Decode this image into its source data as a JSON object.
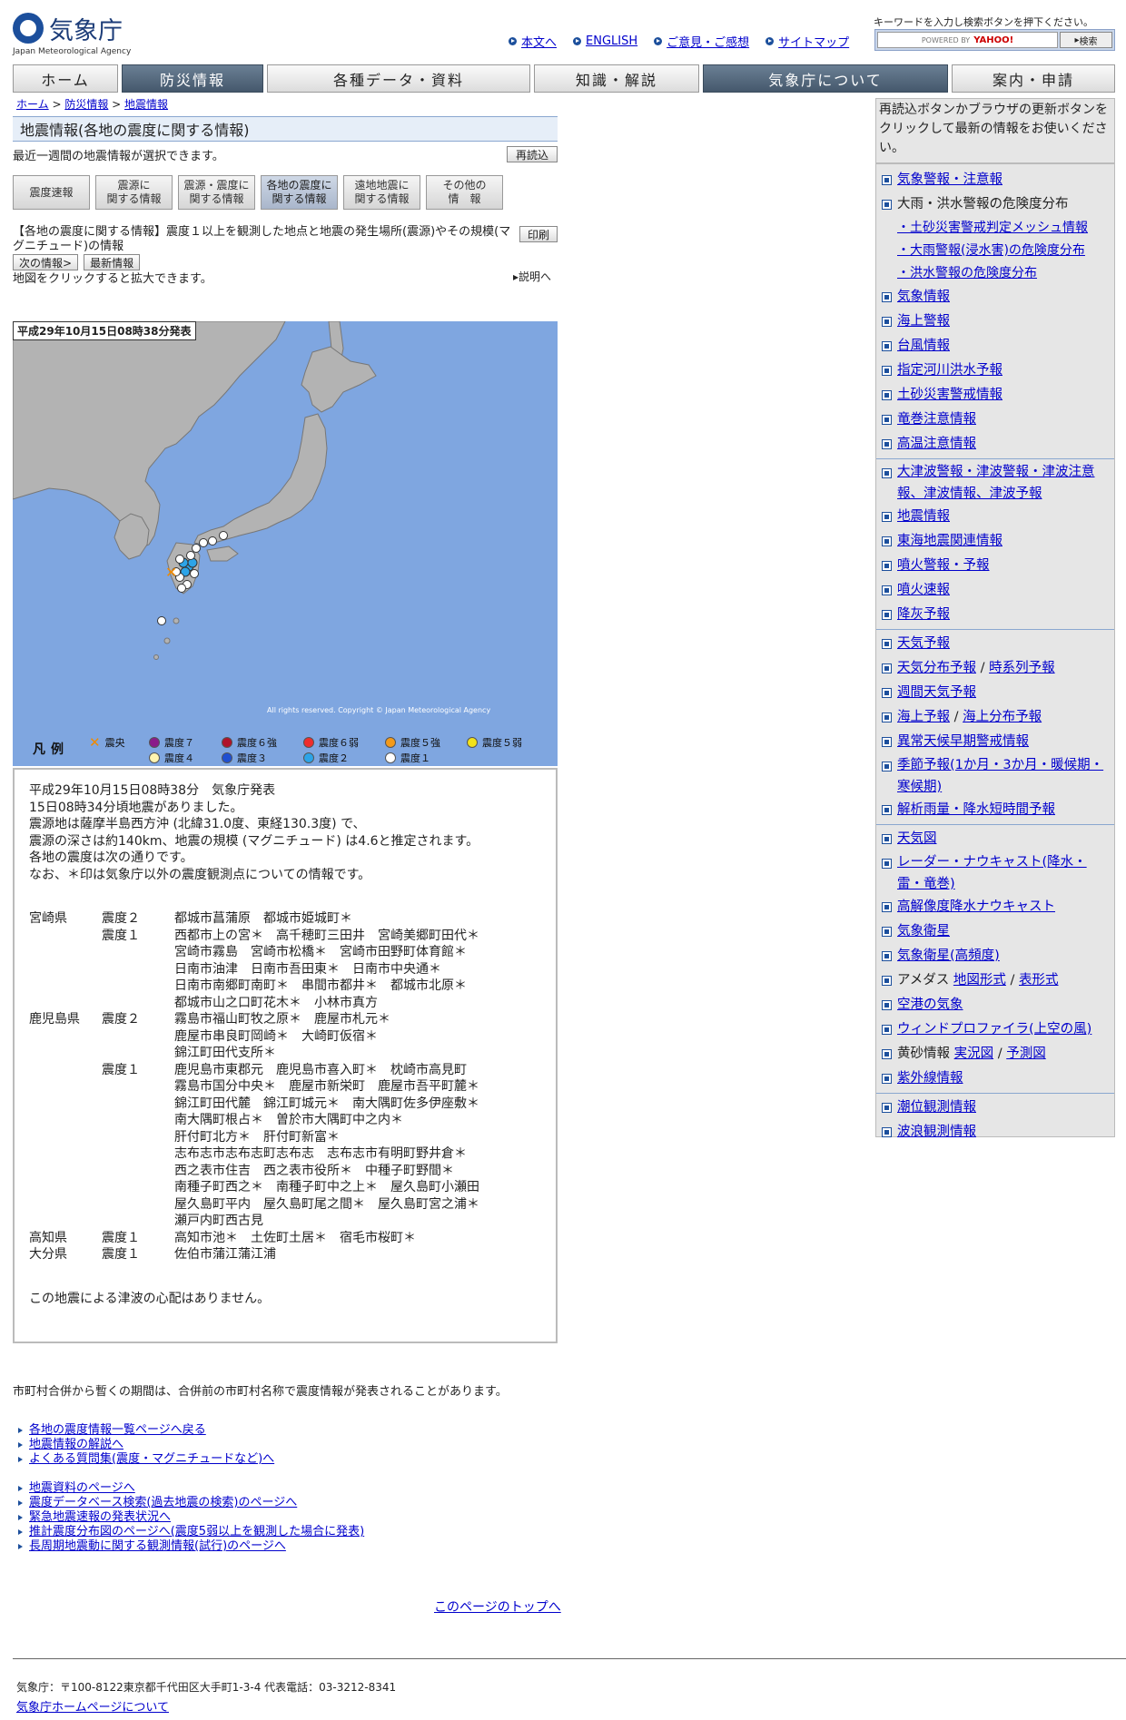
{
  "header": {
    "logo_text": "気象庁",
    "logo_sub": "Japan Meteorological Agency",
    "links": [
      "本文へ",
      "ENGLISH",
      "ご意見・ご感想",
      "サイトマップ"
    ],
    "search_note": "キーワードを入力し検索ボタンを押下ください。",
    "search_powered": "POWERED BY",
    "search_brand": "YAHOO!",
    "search_button": "検索"
  },
  "nav": [
    {
      "label": "ホーム",
      "dark": false
    },
    {
      "label": "防災情報",
      "dark": true
    },
    {
      "label": "各種データ・資料",
      "dark": false
    },
    {
      "label": "知識・解説",
      "dark": false
    },
    {
      "label": "気象庁について",
      "dark": true
    },
    {
      "label": "案内・申請",
      "dark": false
    }
  ],
  "breadcrumb": [
    "ホーム",
    "防災情報",
    "地震情報"
  ],
  "page": {
    "title": "地震情報(各地の震度に関する情報)",
    "subtitle": "最近一週間の地震情報が選択できます。",
    "reload_button": "再読込",
    "print_button": "印刷",
    "tabs": [
      "震度速報",
      "震源に\n関する情報",
      "震源・震度に\n関する情報",
      "各地の震度に\n関する情報",
      "遠地地震に\n関する情報",
      "その他の\n情　報"
    ],
    "active_tab_index": 3,
    "description": "【各地の震度に関する情報】震度１以上を観測した地点と地震の発生場所(震源)やその規模(マグニチュード)の情報",
    "next_button": "次の情報>",
    "latest_button": "最新情報",
    "map_note": "地図をクリックすると拡大できます。",
    "explain_link": "説明へ"
  },
  "map": {
    "stamp": "平成29年10月15日08時38分発表",
    "copyright": "All rights reserved. Copyright © Japan Meteorological Agency",
    "legend_title": "凡例",
    "legend": [
      {
        "label": "震央",
        "kind": "x",
        "color": "#f08a00"
      },
      {
        "label": "震度７",
        "color": "#8a1b8a"
      },
      {
        "label": "震度６強",
        "color": "#b0132a"
      },
      {
        "label": "震度６弱",
        "color": "#ef2d2d"
      },
      {
        "label": "震度５強",
        "color": "#f39a1a"
      },
      {
        "label": "震度５弱",
        "color": "#f2e21a"
      },
      {
        "label": "震度４",
        "color": "#fff4b0"
      },
      {
        "label": "震度３",
        "color": "#1f4fd1"
      },
      {
        "label": "震度２",
        "color": "#2ca4e8"
      },
      {
        "label": "震度１",
        "color": "#ffffff"
      }
    ]
  },
  "report": {
    "lines": [
      "平成29年10月15日08時38分　気象庁発表",
      "15日08時34分頃地震がありました。",
      "震源地は薩摩半島西方沖 (北緯31.0度、東経130.3度) で、",
      "震源の深さは約140km、地震の規模 (マグニチュード) は4.6と推定されます。",
      "各地の震度は次の通りです。",
      "なお、＊印は気象庁以外の震度観測点についての情報です。"
    ],
    "rows": [
      [
        "宮崎県",
        "震度２",
        "都城市菖蒲原　都城市姫城町＊"
      ],
      [
        "",
        "震度１",
        "西都市上の宮＊　高千穂町三田井　宮崎美郷町田代＊"
      ],
      [
        "",
        "",
        "宮崎市霧島　宮崎市松橋＊　宮崎市田野町体育館＊"
      ],
      [
        "",
        "",
        "日南市油津　日南市吾田東＊　日南市中央通＊"
      ],
      [
        "",
        "",
        "日南市南郷町南町＊　串間市都井＊　都城市北原＊"
      ],
      [
        "",
        "",
        "都城市山之口町花木＊　小林市真方"
      ],
      [
        "鹿児島県",
        "震度２",
        "霧島市福山町牧之原＊　鹿屋市札元＊"
      ],
      [
        "",
        "",
        "鹿屋市串良町岡崎＊　大崎町仮宿＊"
      ],
      [
        "",
        "",
        "錦江町田代支所＊"
      ],
      [
        "",
        "震度１",
        "鹿児島市東郡元　鹿児島市喜入町＊　枕崎市高見町"
      ],
      [
        "",
        "",
        "霧島市国分中央＊　鹿屋市新栄町　鹿屋市吾平町麓＊"
      ],
      [
        "",
        "",
        "錦江町田代麓　錦江町城元＊　南大隅町佐多伊座敷＊"
      ],
      [
        "",
        "",
        "南大隅町根占＊　曽於市大隅町中之内＊"
      ],
      [
        "",
        "",
        "肝付町北方＊　肝付町新富＊"
      ],
      [
        "",
        "",
        "志布志市志布志町志布志　志布志市有明町野井倉＊"
      ],
      [
        "",
        "",
        "西之表市住吉　西之表市役所＊　中種子町野間＊"
      ],
      [
        "",
        "",
        "南種子町西之＊　南種子町中之上＊　屋久島町小瀬田"
      ],
      [
        "",
        "",
        "屋久島町平内　屋久島町尾之間＊　屋久島町宮之浦＊"
      ],
      [
        "",
        "",
        "瀬戸内町西古見"
      ],
      [
        "高知県",
        "震度１",
        "高知市池＊　土佐町土居＊　宿毛市桜町＊"
      ],
      [
        "大分県",
        "震度１",
        "佐伯市蒲江蒲江浦"
      ]
    ],
    "tsunami": "この地震による津波の心配はありません。"
  },
  "merge_note": "市町村合併から暫くの期間は、合併前の市町村名称で震度情報が発表されることがあります。",
  "links_group1": [
    "各地の震度情報一覧ページへ戻る",
    "地震情報の解説へ",
    "よくある質問集(震度・マグニチュードなど)へ"
  ],
  "links_group2": [
    "地震資料のページへ",
    "震度データベース検索(過去地震の検索)のページへ",
    "緊急地震速報の発表状況へ",
    "推計震度分布図のページへ(震度5弱以上を観測した場合に発表)",
    "長周期地震動に関する観測情報(試行)のページへ"
  ],
  "to_top": "このページのトップへ",
  "footer": {
    "address": "気象庁：〒100-8122東京都千代田区大手町1-3-4 代表電話：03-3212-8341",
    "about_link": "気象庁ホームページについて"
  },
  "sidebar": {
    "note": "再読込ボタンかブラウザの更新ボタンをクリックして最新の情報をお使いください。",
    "groups": [
      {
        "items": [
          {
            "label": "気象警報・注意報",
            "link": true
          },
          {
            "label": "大雨・洪水警報の危険度分布",
            "link": false
          },
          {
            "label": "・土砂災害警戒判定メッシュ情報",
            "sub": true
          },
          {
            "label": "・大雨警報(浸水害)の危険度分布",
            "sub": true
          },
          {
            "label": "・洪水警報の危険度分布",
            "sub": true
          },
          {
            "label": "気象情報",
            "link": true
          },
          {
            "label": "海上警報",
            "link": true
          },
          {
            "label": "台風情報",
            "link": true
          },
          {
            "label": "指定河川洪水予報",
            "link": true
          },
          {
            "label": "土砂災害警戒情報",
            "link": true
          },
          {
            "label": "竜巻注意情報",
            "link": true
          },
          {
            "label": "高温注意情報",
            "link": true
          }
        ]
      },
      {
        "items": [
          {
            "label": "大津波警報・津波警報・津波注意報、津波情報、津波予報",
            "link": true,
            "wrap": true
          },
          {
            "label": "地震情報",
            "link": true
          },
          {
            "label": "東海地震関連情報",
            "link": true
          },
          {
            "label": "噴火警報・予報",
            "link": true
          },
          {
            "label": "噴火速報",
            "link": true
          },
          {
            "label": "降灰予報",
            "link": true
          }
        ]
      },
      {
        "items": [
          {
            "label": "天気予報",
            "link": true
          },
          {
            "label": "天気分布予報",
            "link": true,
            "extra": "時系列予報"
          },
          {
            "label": "週間天気予報",
            "link": true
          },
          {
            "label": "海上予報",
            "link": true,
            "extra": "海上分布予報"
          },
          {
            "label": "異常天候早期警戒情報",
            "link": true
          },
          {
            "label": "季節予報(1か月・3か月・暖候期・寒候期)",
            "link": true,
            "wrap": true
          },
          {
            "label": "解析雨量・降水短時間予報",
            "link": true
          }
        ]
      },
      {
        "items": [
          {
            "label": "天気図",
            "link": true
          },
          {
            "label": "レーダー・ナウキャスト(降水・雷・竜巻)",
            "link": true,
            "wrap": true
          },
          {
            "label": "高解像度降水ナウキャスト",
            "link": true
          },
          {
            "label": "気象衛星",
            "link": true
          },
          {
            "label": "気象衛星(高頻度)",
            "link": true
          },
          {
            "label": "アメダス",
            "link": false,
            "extra_links": [
              "地図形式",
              "表形式"
            ]
          },
          {
            "label": "空港の気象",
            "link": true
          },
          {
            "label": "ウィンドプロファイラ(上空の風)",
            "link": true
          },
          {
            "label": "黄砂情報",
            "link": false,
            "extra_links": [
              "実況図",
              "予測図"
            ]
          },
          {
            "label": "紫外線情報",
            "link": true
          }
        ]
      },
      {
        "items": [
          {
            "label": "潮位観測情報",
            "link": true
          },
          {
            "label": "波浪観測情報",
            "link": true
          }
        ]
      }
    ]
  },
  "colors": {
    "brand": "#1c4f9c",
    "nav_dark": "#4f6377",
    "sea": "#7fa6e0",
    "land": "#b3b3b3"
  }
}
